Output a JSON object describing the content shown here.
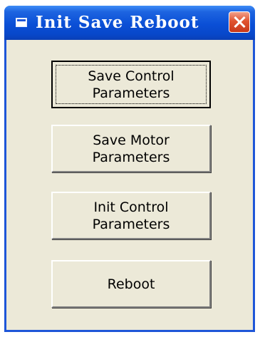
{
  "window": {
    "title": "Init Save Reboot",
    "title_icon": "window-icon",
    "close_icon": "close-icon"
  },
  "buttons": [
    {
      "label": "Save Control\nParameters",
      "focused": true
    },
    {
      "label": "Save Motor\nParameters",
      "focused": false
    },
    {
      "label": "Init Control\nParameters",
      "focused": false
    },
    {
      "label": "Reboot",
      "focused": false
    }
  ],
  "colors": {
    "titlebar": "#0a4fd6",
    "window_bg": "#ece9d8",
    "close_button": "#e0532f"
  }
}
